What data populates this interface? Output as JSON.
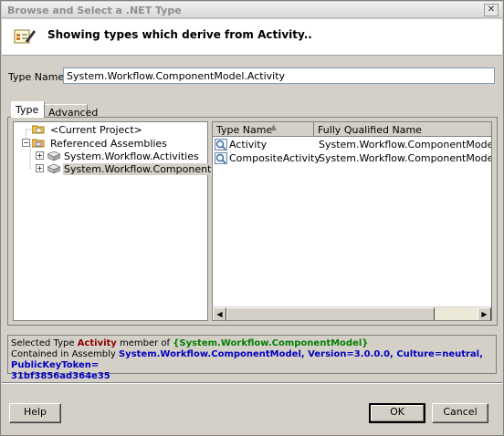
{
  "window": {
    "title": "Browse and Select a .NET Type"
  },
  "header": {
    "text": "Showing types which derive from Activity.."
  },
  "type_name": {
    "label": "Type Name:",
    "value": "System.Workflow.ComponentModel.Activity"
  },
  "tabs": [
    {
      "label": "Type"
    },
    {
      "label": "Advanced"
    }
  ],
  "tree": {
    "items": [
      {
        "label": "<Current Project>"
      },
      {
        "label": "Referenced Assemblies"
      },
      {
        "label": "System.Workflow.Activities"
      },
      {
        "label": "System.Workflow.ComponentModel"
      }
    ]
  },
  "list": {
    "columns": [
      {
        "label": "Type Name"
      },
      {
        "label": "Fully Qualified Name"
      }
    ],
    "rows": [
      {
        "name": "Activity",
        "fqn": "System.Workflow.ComponentModel.Activity"
      },
      {
        "name": "CompositeActivity",
        "fqn": "System.Workflow.ComponentModel.Compos"
      }
    ]
  },
  "info": {
    "selected_prefix": "Selected Type",
    "selected_type": "Activity",
    "member_of": "member of",
    "namespace": "{System.Workflow.ComponentModel}",
    "contained_prefix": "Contained in Assembly",
    "assembly": "System.Workflow.ComponentModel, Version=3.0.0.0, Culture=neutral, PublicKeyToken=",
    "assembly_cont": "31bf3856ad364e35"
  },
  "buttons": {
    "help": "Help",
    "ok": "OK",
    "cancel": "Cancel"
  },
  "icons": {
    "close": "close-icon",
    "header": "type-browser-icon",
    "folder": "folder-icon",
    "assembly": "assembly-icon",
    "class": "class-icon"
  }
}
